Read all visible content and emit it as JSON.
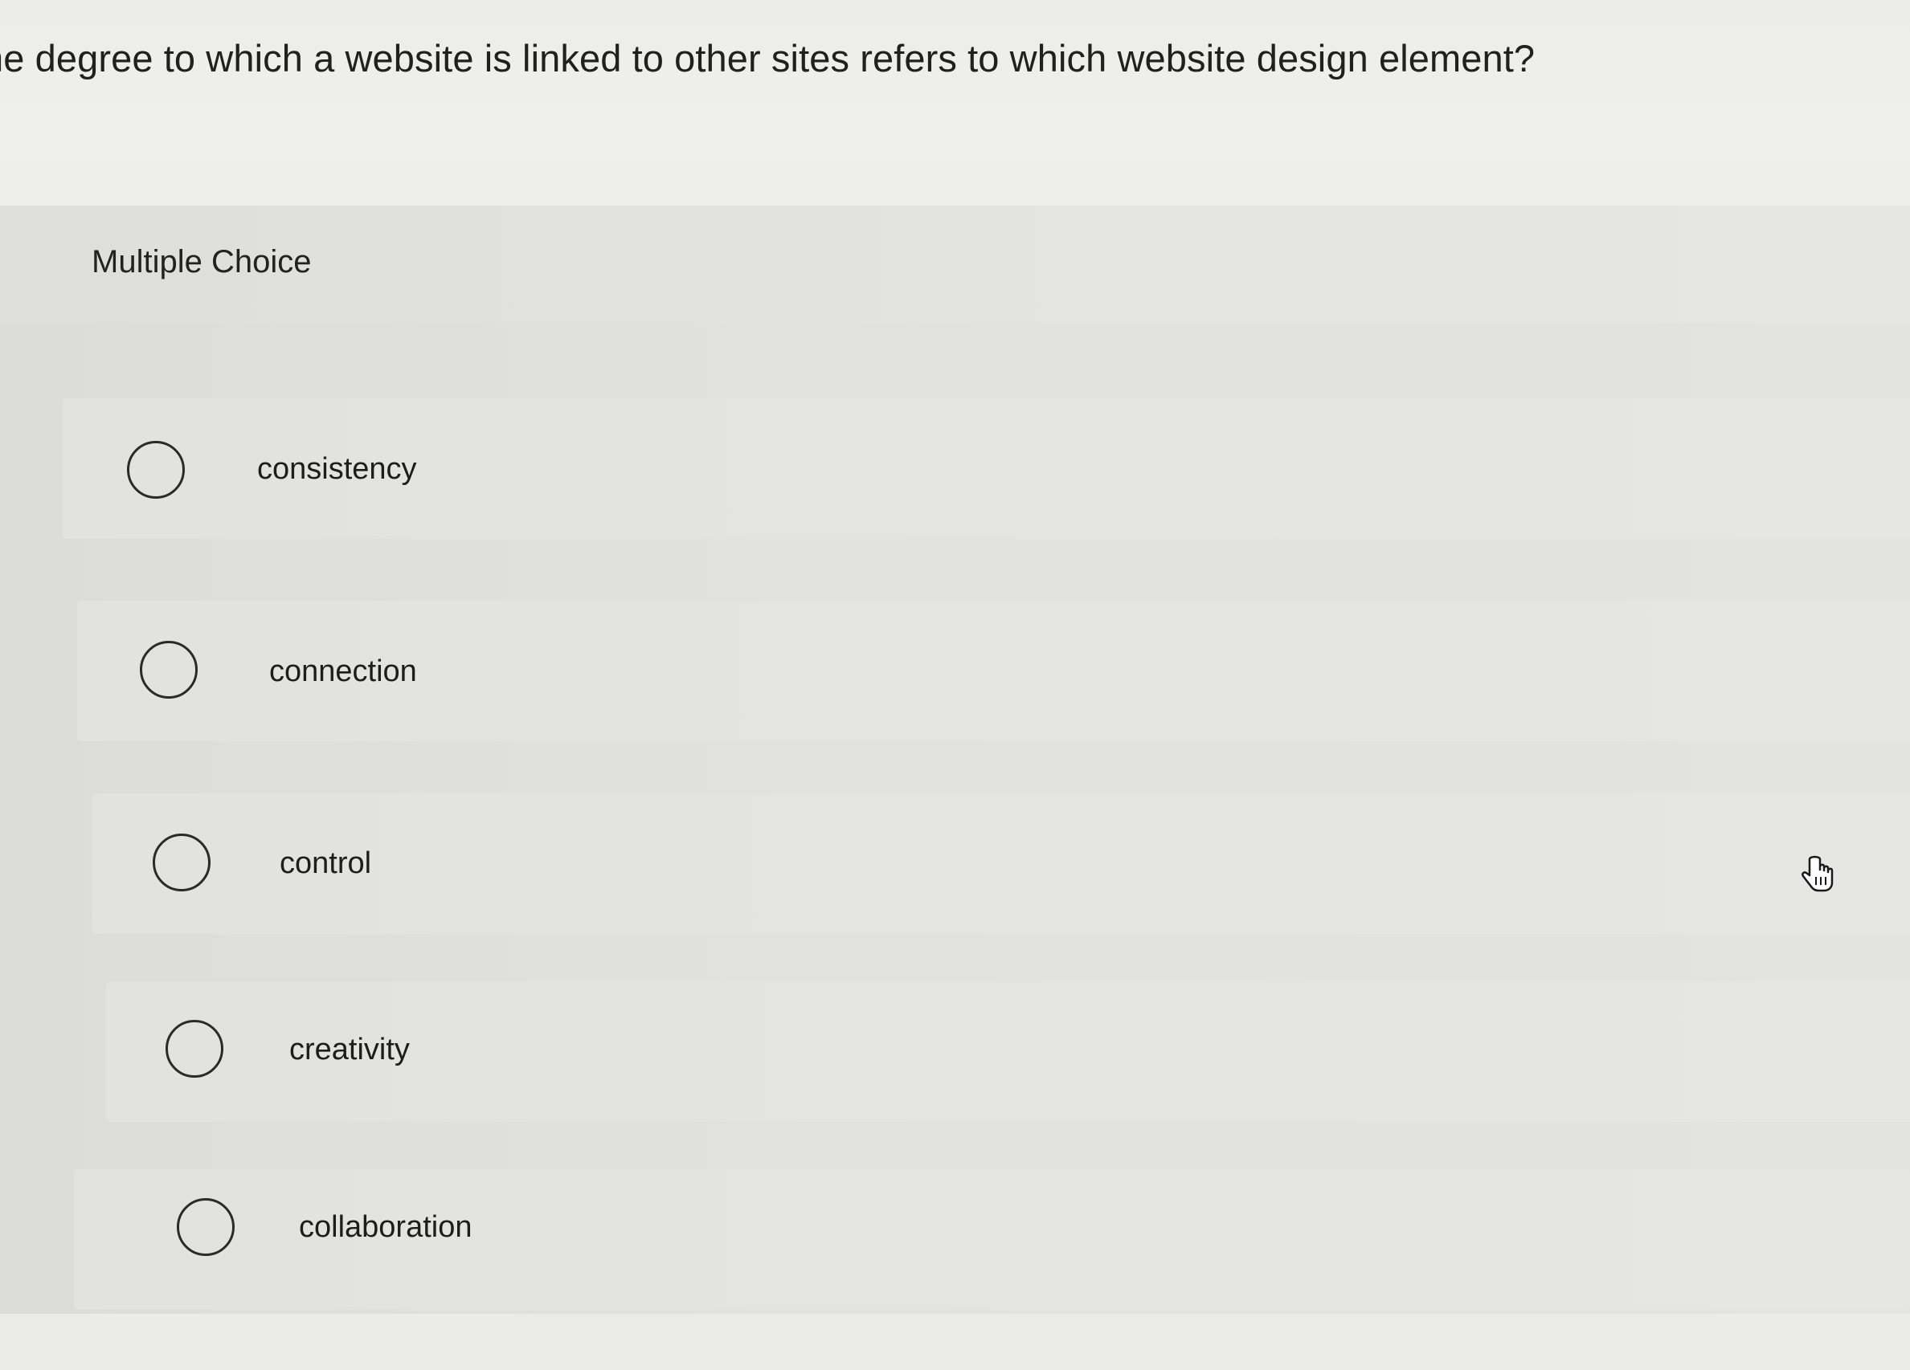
{
  "question": {
    "text": "he degree to which a website is linked to other sites refers to which website design element?"
  },
  "multiple_choice": {
    "label": "Multiple Choice",
    "options": [
      {
        "label": "consistency",
        "selected": false
      },
      {
        "label": "connection",
        "selected": false
      },
      {
        "label": "control",
        "selected": false
      },
      {
        "label": "creativity",
        "selected": false
      },
      {
        "label": "collaboration",
        "selected": false
      }
    ]
  },
  "cursor": {
    "icon": "hand-pointer-icon"
  },
  "colors": {
    "background": "#ebebea",
    "panel": "#e2e2e0",
    "text": "#1f1f1f",
    "radio_border": "#2a2a2a"
  }
}
